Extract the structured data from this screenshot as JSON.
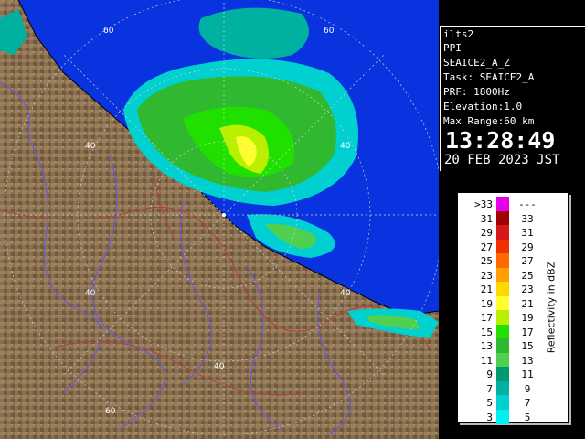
{
  "info": {
    "station": "ilts2",
    "scan_type": "PPI",
    "product": "SEAICE2_A_Z",
    "task": "Task: SEAICE2_A",
    "prf": "PRF: 1800Hz",
    "elevation": "Elevation:1.0",
    "max_range": "Max Range:60 km",
    "time": "13:28:49",
    "date": "20 FEB 2023 JST"
  },
  "legend": {
    "title": "Reflectivity in dBZ",
    "rows": [
      {
        "low": ">33",
        "high": "---",
        "color": "#e800e8"
      },
      {
        "low": "31",
        "high": "33",
        "color": "#a00000"
      },
      {
        "low": "29",
        "high": "31",
        "color": "#d81818"
      },
      {
        "low": "27",
        "high": "29",
        "color": "#f03000"
      },
      {
        "low": "25",
        "high": "27",
        "color": "#ff6a00"
      },
      {
        "low": "23",
        "high": "25",
        "color": "#ffa000"
      },
      {
        "low": "21",
        "high": "23",
        "color": "#ffd800"
      },
      {
        "low": "19",
        "high": "21",
        "color": "#ffff30"
      },
      {
        "low": "17",
        "high": "19",
        "color": "#b8f000"
      },
      {
        "low": "15",
        "high": "17",
        "color": "#20e000"
      },
      {
        "low": "13",
        "high": "15",
        "color": "#30b830"
      },
      {
        "low": "11",
        "high": "13",
        "color": "#50d050"
      },
      {
        "low": "9",
        "high": "11",
        "color": "#009a70"
      },
      {
        "low": "7",
        "high": "9",
        "color": "#00b0a0"
      },
      {
        "low": "5",
        "high": "7",
        "color": "#00d0d0"
      },
      {
        "low": "3",
        "high": "5",
        "color": "#00f0f0"
      }
    ]
  },
  "map": {
    "range_labels": [
      "60",
      "60",
      "40",
      "40",
      "40",
      "40",
      "40",
      "60"
    ],
    "colors": {
      "sea": "#0a33e0",
      "land": "#8a7050",
      "grid": "#d0d0d0",
      "river": "#6a5ad8",
      "boundary": "#b04040"
    }
  }
}
